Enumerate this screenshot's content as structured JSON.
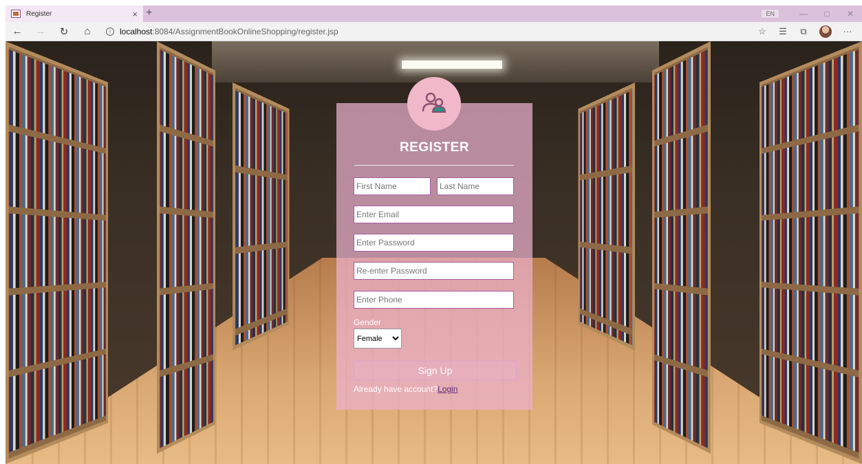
{
  "browser": {
    "tab_title": "Register",
    "tab_close": "×",
    "new_tab": "+",
    "language": "EN",
    "url_host": "localhost",
    "url_path": ":8084/AssignmentBookOnlineShopping/register.jsp",
    "nav": {
      "back": "←",
      "forward": "→",
      "refresh": "↻",
      "home": "⌂"
    },
    "icons": {
      "favorite": "☆",
      "favorites_bar": "☰",
      "collections": "⧉",
      "more": "···"
    },
    "window": {
      "minimize": "—",
      "maximize": "□",
      "close": "✕"
    }
  },
  "register": {
    "icon": "users-icon",
    "title": "REGISTER",
    "first_name_placeholder": "First Name",
    "last_name_placeholder": "Last Name",
    "email_placeholder": "Enter Email",
    "password_placeholder": "Enter Password",
    "reenter_password_placeholder": "Re-enter Password",
    "phone_placeholder": "Enter Phone",
    "gender_label": "Gender",
    "gender_selected": "Female",
    "signup_label": "Sign Up",
    "login_prompt": "Already have account?",
    "login_link": "Login"
  },
  "colors": {
    "card": "#ecb2cd",
    "icon_circle": "#f1b8c9",
    "field_border": "#a85aa0",
    "icon_stroke": "#8a5070",
    "icon_accent": "#2e8e86"
  }
}
